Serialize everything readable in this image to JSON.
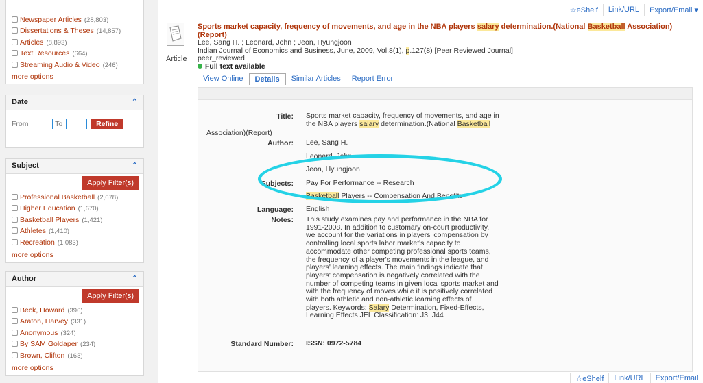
{
  "facets": {
    "format_items": [
      {
        "label": "Newspaper Articles",
        "count": "(28,803)"
      },
      {
        "label": "Dissertations & Theses",
        "count": "(14,857)"
      },
      {
        "label": "Articles",
        "count": "(8,893)"
      },
      {
        "label": "Text Resources",
        "count": "(664)"
      },
      {
        "label": "Streaming Audio & Video",
        "count": "(246)"
      }
    ],
    "format_more": "more options",
    "date": {
      "title": "Date",
      "from_label": "From",
      "to_label": "To",
      "refine": "Refine",
      "from_value": "",
      "to_value": ""
    },
    "subject": {
      "title": "Subject",
      "apply": "Apply Filter(s)",
      "items": [
        {
          "label": "Professional Basketball",
          "count": "(2,678)"
        },
        {
          "label": "Higher Education",
          "count": "(1,670)"
        },
        {
          "label": "Basketball Players",
          "count": "(1,421)"
        },
        {
          "label": "Athletes",
          "count": "(1,410)"
        },
        {
          "label": "Recreation",
          "count": "(1,083)"
        }
      ],
      "more": "more options"
    },
    "author": {
      "title": "Author",
      "apply": "Apply Filter(s)",
      "items": [
        {
          "label": "Beck, Howard",
          "count": "(396)"
        },
        {
          "label": "Araton, Harvey",
          "count": "(331)"
        },
        {
          "label": "Anonymous",
          "count": "(324)"
        },
        {
          "label": "By SAM Goldaper",
          "count": "(234)"
        },
        {
          "label": "Brown, Clifton",
          "count": "(163)"
        }
      ],
      "more": "more options"
    }
  },
  "toolbar": {
    "eshelf": "☆eShelf",
    "link": "Link/URL",
    "export": "Export/Email ▾"
  },
  "record": {
    "type": "Article",
    "title_a": "Sports market capacity, frequency of movements, and age in the NBA players ",
    "title_hl1": "salary",
    "title_b": " determination.(National ",
    "title_hl2": "Basketball",
    "title_c": " Association)(Report)",
    "authors": "Lee, Sang H. ; Leonard, John ; Jeon, Hyungjoon",
    "source_a": "Indian Journal of Economics and Business, June, 2009, Vol.8(1), ",
    "source_p": "p",
    "source_b": ".127(8) [Peer Reviewed Journal]",
    "peer": "peer_reviewed",
    "fulltext": "Full text available"
  },
  "tabs": [
    "View Online",
    "Details",
    "Similar Articles",
    "Report Error"
  ],
  "details": {
    "title_label": "Title:",
    "title_l1": "Sports market capacity, frequency of movements, and age in",
    "title_l2a": "the NBA players ",
    "title_l2hl": "salary",
    "title_l2b": " determination.(National ",
    "title_l2hl2": "Basketball",
    "title_l3": "Association)(Report)",
    "author_label": "Author:",
    "authors": [
      "Lee, Sang H.",
      "Leonard, John",
      "Jeon, Hyungjoon"
    ],
    "subjects_label": "Subjects:",
    "subject1": "Pay For Performance -- Research",
    "subject2_hl": "Basketball",
    "subject2_rest": " Players -- Compensation And Benefits",
    "language_label": "Language:",
    "language": "English",
    "notes_label": "Notes:",
    "notes_lines": [
      "This study examines pay and performance in the NBA for",
      "1991-2008. In addition to customary on-court productivity,",
      "we account for the variations in players' compensation by",
      "controlling local sports labor market's capacity to",
      "accommodate other competing professional sports teams,",
      "the frequency of a player's movements in the league, and",
      "players' learning effects. The main findings indicate that",
      "players' compensation is negatively correlated with the",
      "number of competing teams in given local sports market and",
      "with the frequency of moves while it is positively correlated",
      "with both athletic and non-athletic learning effects of"
    ],
    "notes_l12a": "players. Keywords: ",
    "notes_l12hl": "Salary",
    "notes_l12b": " Determination, Fixed-Effects,",
    "notes_l13": "Learning Effects JEL Classification: J3, J44",
    "std_label": "Standard Number:",
    "std_value": "ISSN: 0972-5784"
  },
  "bottom_toolbar": {
    "eshelf": "☆eShelf",
    "link": "Link/URL",
    "export": "Export/Email"
  }
}
